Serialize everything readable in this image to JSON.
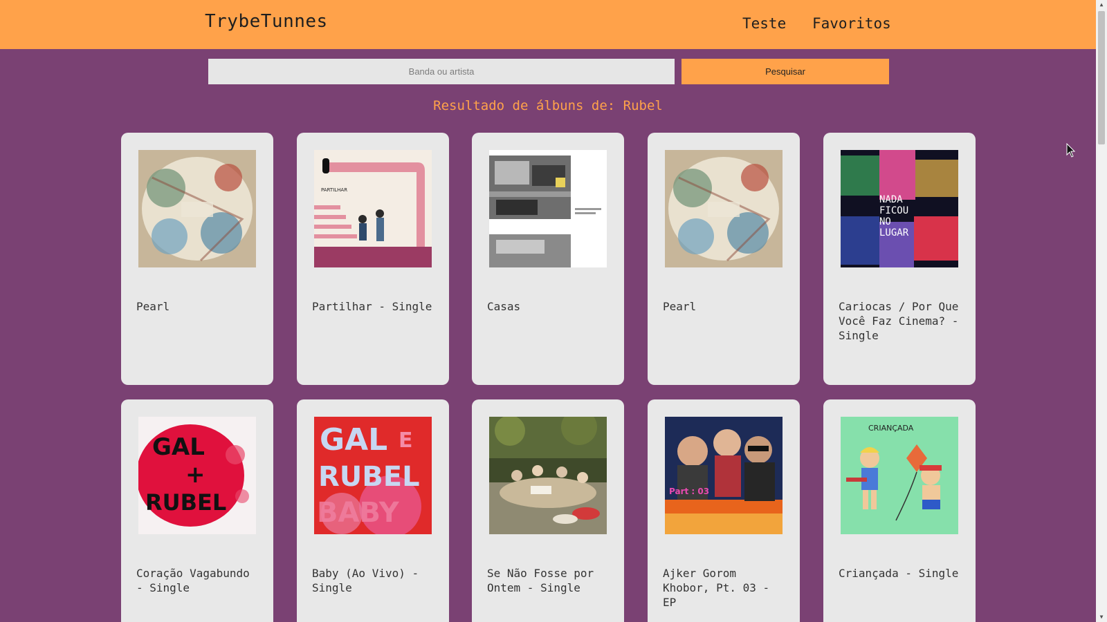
{
  "header": {
    "brand": "TrybeTunnes",
    "nav": {
      "teste": "Teste",
      "favoritos": "Favoritos"
    }
  },
  "search": {
    "placeholder": "Banda ou artista",
    "value": "",
    "button_label": "Pesquisar"
  },
  "results": {
    "title": "Resultado de álbuns de: Rubel",
    "albums": [
      {
        "title": "Pearl"
      },
      {
        "title": "Partilhar - Single"
      },
      {
        "title": "Casas"
      },
      {
        "title": "Pearl"
      },
      {
        "title": "Cariocas / Por Que Você Faz Cinema? - Single"
      },
      {
        "title": "Coração Vagabundo - Single"
      },
      {
        "title": "Baby (Ao Vivo) - Single"
      },
      {
        "title": "Se Não Fosse por Ontem - Single"
      },
      {
        "title": "Ajker Gorom Khobor, Pt. 03 - EP"
      },
      {
        "title": "Criançada - Single"
      }
    ]
  },
  "cover_text": {
    "partilhar": "PARTILHAR",
    "nada": [
      "NADA",
      "FICOU",
      "NO",
      "LUGAR"
    ],
    "gal": [
      "GAL",
      "+",
      "RUBEL"
    ],
    "baby": [
      "GAL",
      "E",
      "RUBEL",
      "BABY"
    ],
    "criancada": "CRIANÇADA",
    "part": "Part : 03"
  },
  "colors": {
    "header": "#ffa24a",
    "background": "#7a4173",
    "card": "#e8e8e8",
    "search_field": "#e6e6e6",
    "accent": "#ffa24a"
  }
}
